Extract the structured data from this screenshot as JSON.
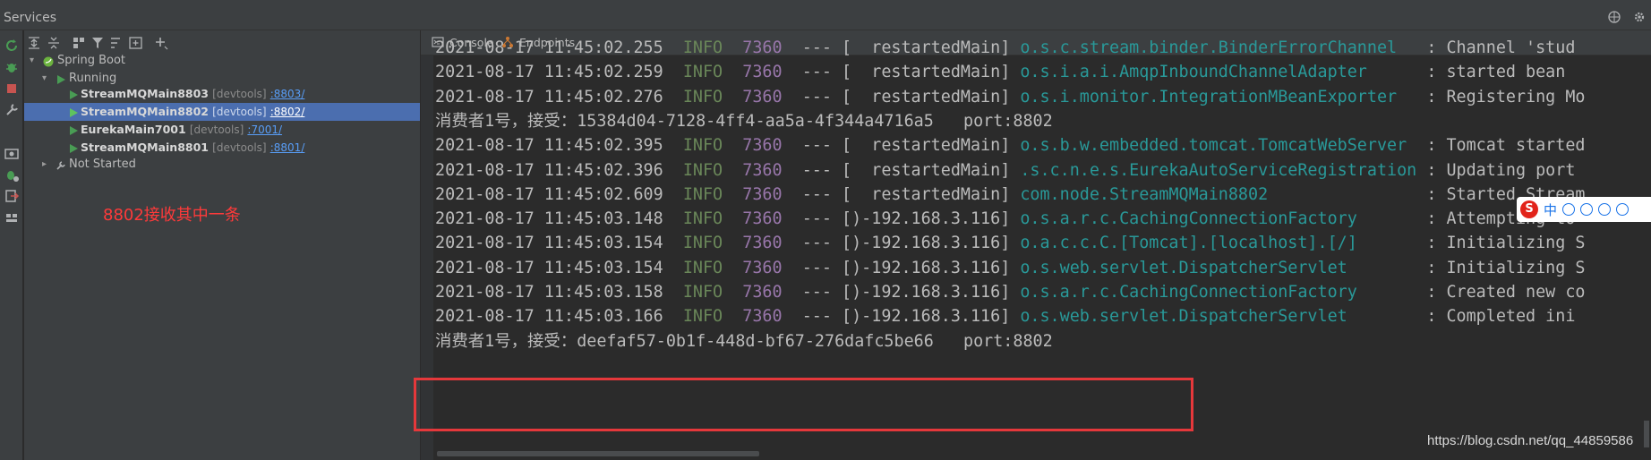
{
  "window": {
    "title": "Services"
  },
  "tree": {
    "root": "Spring Boot",
    "running_group": "Running",
    "not_started_group": "Not Started",
    "services": [
      {
        "name": "StreamMQMain8803",
        "tag": "[devtools]",
        "port": ":8803/",
        "selected": false
      },
      {
        "name": "StreamMQMain8802",
        "tag": "[devtools]",
        "port": ":8802/",
        "selected": true
      },
      {
        "name": "EurekaMain7001",
        "tag": "[devtools]",
        "port": ":7001/",
        "selected": false
      },
      {
        "name": "StreamMQMain8801",
        "tag": "[devtools]",
        "port": ":8801/",
        "selected": false
      }
    ],
    "annotation": "8802接收其中一条"
  },
  "tabs": [
    {
      "label": "Console",
      "icon": "console-icon"
    },
    {
      "label": "Endpoints",
      "icon": "endpoints-icon"
    }
  ],
  "log_lines": [
    {
      "type": "log",
      "ts": "2021-08-17 11:45:02.255",
      "level": "INFO",
      "pid": "7360",
      "sep": "--- [",
      "thread": "  restartedMain] ",
      "logger": "o.s.c.stream.binder.BinderErrorChannel",
      "pad": "   ",
      "msg": ": Channel 'stud"
    },
    {
      "type": "log",
      "ts": "2021-08-17 11:45:02.259",
      "level": "INFO",
      "pid": "7360",
      "sep": "--- [",
      "thread": "  restartedMain] ",
      "logger": "o.s.i.a.i.AmqpInboundChannelAdapter",
      "pad": "      ",
      "msg": ": started bean"
    },
    {
      "type": "log",
      "ts": "2021-08-17 11:45:02.276",
      "level": "INFO",
      "pid": "7360",
      "sep": "--- [",
      "thread": "  restartedMain] ",
      "logger": "o.s.i.monitor.IntegrationMBeanExporter",
      "pad": "   ",
      "msg": ": Registering Mo"
    },
    {
      "type": "plain",
      "text": "消费者1号，接受：15384d04-7128-4ff4-aa5a-4f344a4716a5   port:8802"
    },
    {
      "type": "log",
      "ts": "2021-08-17 11:45:02.395",
      "level": "INFO",
      "pid": "7360",
      "sep": "--- [",
      "thread": "  restartedMain] ",
      "logger": "o.s.b.w.embedded.tomcat.TomcatWebServer",
      "pad": "  ",
      "msg": ": Tomcat started"
    },
    {
      "type": "log",
      "ts": "2021-08-17 11:45:02.396",
      "level": "INFO",
      "pid": "7360",
      "sep": "--- [",
      "thread": "  restartedMain] ",
      "logger": ".s.c.n.e.s.EurekaAutoServiceRegistration",
      "pad": " ",
      "msg": ": Updating port"
    },
    {
      "type": "log",
      "ts": "2021-08-17 11:45:02.609",
      "level": "INFO",
      "pid": "7360",
      "sep": "--- [",
      "thread": "  restartedMain] ",
      "logger": "com.node.StreamMQMain8802",
      "pad": "                ",
      "msg": ": Started Stream"
    },
    {
      "type": "log",
      "ts": "2021-08-17 11:45:03.148",
      "level": "INFO",
      "pid": "7360",
      "sep": "--- [",
      "thread": ")-192.168.3.116] ",
      "logger": "o.s.a.r.c.CachingConnectionFactory",
      "pad": "       ",
      "msg": ": Attempting to"
    },
    {
      "type": "log",
      "ts": "2021-08-17 11:45:03.154",
      "level": "INFO",
      "pid": "7360",
      "sep": "--- [",
      "thread": ")-192.168.3.116] ",
      "logger": "o.a.c.c.C.[Tomcat].[localhost].[/]",
      "pad": "       ",
      "msg": ": Initializing S"
    },
    {
      "type": "log",
      "ts": "2021-08-17 11:45:03.154",
      "level": "INFO",
      "pid": "7360",
      "sep": "--- [",
      "thread": ")-192.168.3.116] ",
      "logger": "o.s.web.servlet.DispatcherServlet",
      "pad": "        ",
      "msg": ": Initializing S"
    },
    {
      "type": "log",
      "ts": "2021-08-17 11:45:03.158",
      "level": "INFO",
      "pid": "7360",
      "sep": "--- [",
      "thread": ")-192.168.3.116] ",
      "logger": "o.s.a.r.c.CachingConnectionFactory",
      "pad": "       ",
      "msg": ": Created new co"
    },
    {
      "type": "log",
      "ts": "2021-08-17 11:45:03.166",
      "level": "INFO",
      "pid": "7360",
      "sep": "--- [",
      "thread": ")-192.168.3.116] ",
      "logger": "o.s.web.servlet.DispatcherServlet",
      "pad": "        ",
      "msg": ": Completed ini"
    },
    {
      "type": "plain",
      "text": "消费者1号，接受：deefaf57-0b1f-448d-bf67-276dafc5be66   port:8802"
    }
  ],
  "ime": {
    "logo": "S",
    "lang": "中"
  },
  "watermark": "https://blog.csdn.net/qq_44859586",
  "colors": {
    "accent_red": "#e5383b",
    "selection": "#4b6eaf",
    "run_green": "#499c54",
    "logger_teal": "#299999",
    "level_green": "#6a8759",
    "pid_purple": "#9876aa"
  }
}
